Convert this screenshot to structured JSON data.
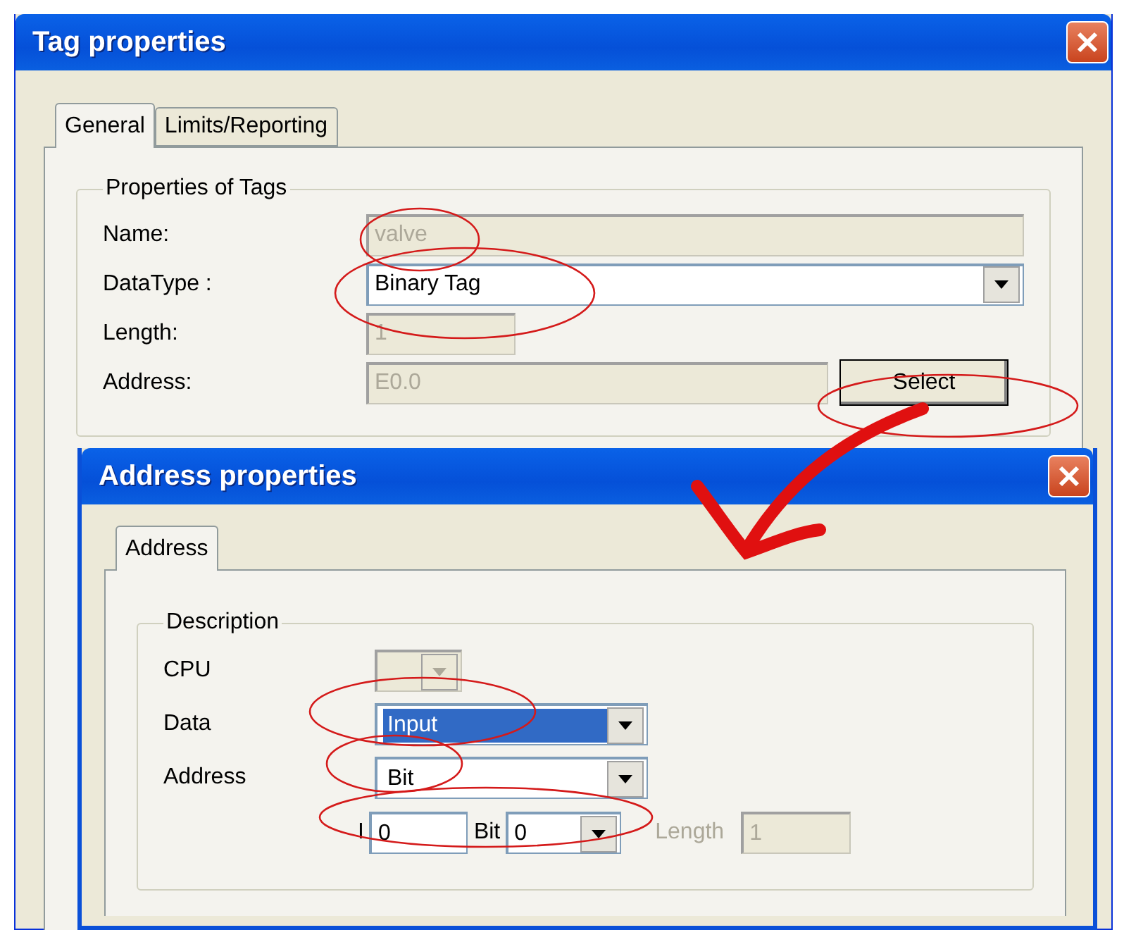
{
  "window": {
    "title": "Tag properties",
    "tabs": [
      {
        "label": "General",
        "selected": true
      },
      {
        "label": "Limits/Reporting",
        "selected": false
      }
    ],
    "group": {
      "title": "Properties of Tags",
      "fields": [
        {
          "label": "Name:",
          "value": "valve",
          "kind": "text",
          "disabled": true
        },
        {
          "label": "DataType :",
          "value": "Binary Tag",
          "kind": "combo",
          "disabled": false
        },
        {
          "label": "Length:",
          "value": "1",
          "kind": "short",
          "disabled": true
        },
        {
          "label": "Address:",
          "value": "E0.0",
          "kind": "address",
          "disabled": true,
          "button": "Select"
        }
      ]
    }
  },
  "dialog": {
    "title": "Address properties",
    "tabs": [
      {
        "label": "Address",
        "selected": true
      }
    ],
    "group": {
      "title": "Description",
      "cpu": {
        "label": "CPU",
        "disabled": true
      },
      "data": {
        "label": "Data",
        "value": "Input",
        "selected": true
      },
      "address": {
        "label": "Address",
        "value": "Bit",
        "selected": false
      },
      "bit_row": {
        "prefix": "I",
        "byte": "0",
        "bit_label": "Bit",
        "bit": "0",
        "length_label": "Length",
        "length": "1",
        "length_disabled": true
      }
    }
  }
}
